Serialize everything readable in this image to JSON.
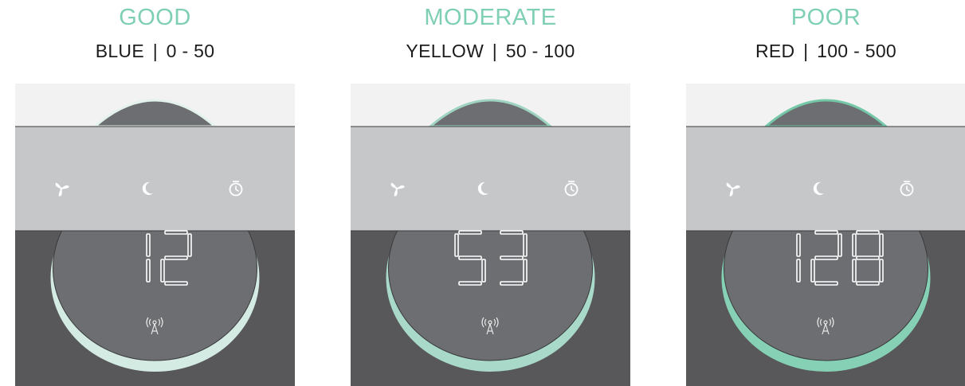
{
  "panels": [
    {
      "label": "GOOD",
      "color_name": "BLUE",
      "separator": "|",
      "range": "0 - 50",
      "reading": "12",
      "digits": [
        "1",
        "2"
      ],
      "ring_color": "#d3ebe3",
      "ring_stroke": "#e4f2ec"
    },
    {
      "label": "MODERATE",
      "color_name": "YELLOW",
      "separator": "|",
      "range": "50 - 100",
      "reading": "53",
      "digits": [
        "5",
        "3"
      ],
      "ring_color": "#a9dac9",
      "ring_stroke": "#9fd4c1"
    },
    {
      "label": "POOR",
      "color_name": "RED",
      "separator": "|",
      "range": "100 - 500",
      "reading": "128",
      "digits": [
        "1",
        "2",
        "8"
      ],
      "ring_color": "#86d1b5",
      "ring_stroke": "#74c8a8"
    }
  ],
  "colors": {
    "title_accent": "#7fcfb3",
    "top_surface": "#f2f2f3",
    "button_band": "#c6c7c9",
    "body_dark": "#58585a",
    "display_disc": "#6d6e71",
    "icon_white": "#ffffff",
    "digit_white": "#ffffff"
  },
  "icons": {
    "fan": "fan-icon",
    "sleep": "moon-icon",
    "timer": "timer-icon",
    "sensor": "signal-tower-icon"
  }
}
